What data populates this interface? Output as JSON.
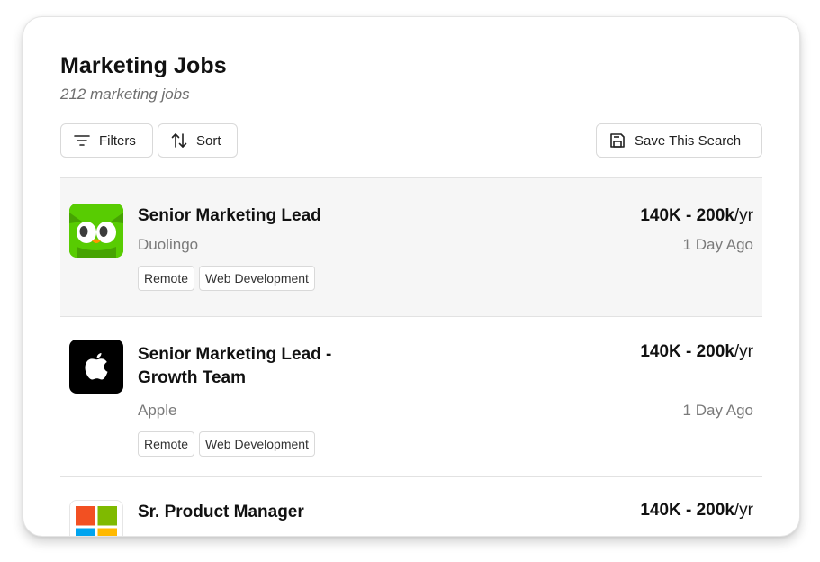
{
  "header": {
    "title": "Marketing Jobs",
    "subtitle": "212 marketing jobs"
  },
  "toolbar": {
    "filters_label": "Filters",
    "sort_label": "Sort",
    "save_search_label": "Save This Search"
  },
  "jobs": [
    {
      "title": "Senior Marketing Lead",
      "company": "Duolingo",
      "logo_icon": "duolingo-owl-icon",
      "tags": [
        "Remote",
        "Web Development"
      ],
      "salary": "140K - 200k",
      "salary_period": "/yr",
      "posted": "1 Day Ago"
    },
    {
      "title": "Senior Marketing Lead - Growth Team",
      "company": "Apple",
      "logo_icon": "apple-logo-icon",
      "tags": [
        "Remote",
        "Web Development"
      ],
      "salary": "140K - 200k",
      "salary_period": "/yr",
      "posted": "1 Day Ago"
    },
    {
      "title": "Sr. Product Manager",
      "company": "",
      "logo_icon": "microsoft-logo-icon",
      "tags": [],
      "salary": "140K - 200k",
      "salary_period": "/yr",
      "posted": ""
    }
  ],
  "colors": {
    "duolingo_green": "#58cc02",
    "row_highlight": "#f6f6f6",
    "ms_red": "#f25022",
    "ms_green": "#7fba00",
    "ms_blue": "#00a4ef",
    "ms_yellow": "#ffb900"
  }
}
